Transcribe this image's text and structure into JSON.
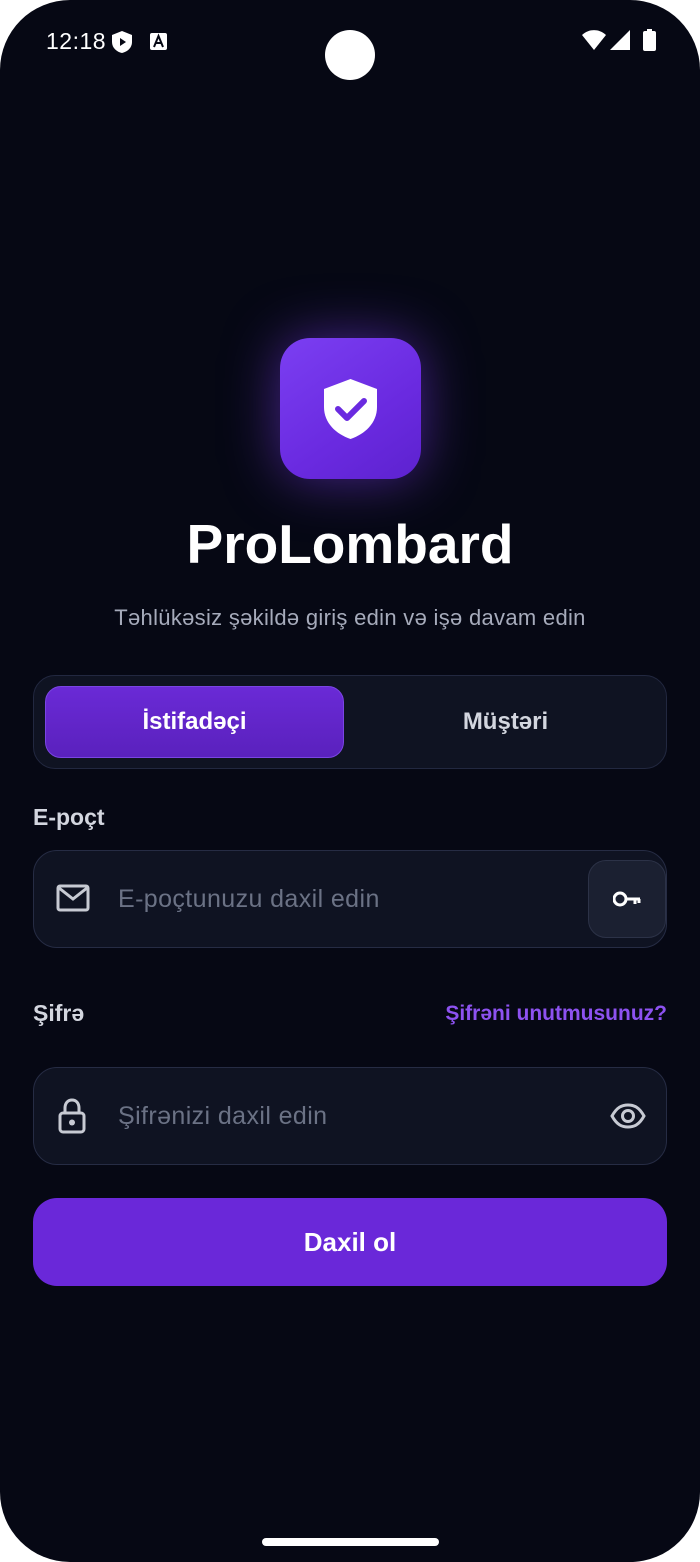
{
  "status_bar": {
    "time": "12:18",
    "icons": [
      "shield-play-icon",
      "accessibility-a-icon",
      "wifi-icon",
      "signal-icon",
      "battery-icon"
    ]
  },
  "app": {
    "logo_icon": "shield-check-icon",
    "title": "ProLombard",
    "subtitle": "Təhlükəsiz şəkildə giriş edin və işə davam edin",
    "accent_color": "#6a28d9"
  },
  "tabs": [
    {
      "label": "İstifadəçi",
      "active": true
    },
    {
      "label": "Müştəri",
      "active": false
    }
  ],
  "email": {
    "label": "E-poçt",
    "placeholder": "E-poçtunuzu daxil edin",
    "value": "",
    "lead_icon": "mail-icon",
    "action_icon": "key-icon"
  },
  "password": {
    "label": "Şifrə",
    "forgot_label": "Şifrəni unutmusunuz?",
    "placeholder": "Şifrənizi daxil edin",
    "value": "",
    "lead_icon": "lock-icon",
    "toggle_icon": "eye-icon"
  },
  "submit": {
    "label": "Daxil ol"
  }
}
